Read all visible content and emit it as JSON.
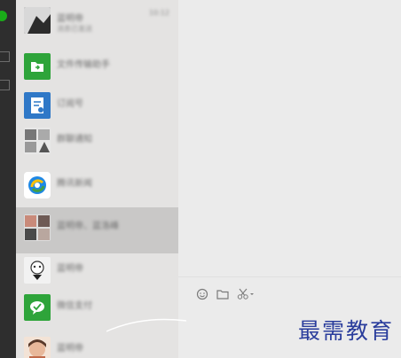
{
  "sidebar": {
    "colors": {
      "rail": "#2e2e2e",
      "active": "#1aad19"
    }
  },
  "chats": [
    {
      "name": "蓝明帝",
      "preview": "消息已发送",
      "time": "10:12",
      "avatar_icon": "photo-avatar-icon"
    },
    {
      "name": "文件传输助手",
      "preview": "",
      "time": "",
      "avatar_icon": "file-transfer-icon"
    },
    {
      "name": "订阅号",
      "preview": "",
      "time": "",
      "avatar_icon": "subscription-icon"
    },
    {
      "name": "群聊通知",
      "preview": "",
      "time": "",
      "avatar_icon": "group-avatar-icon"
    },
    {
      "name": "腾讯新闻",
      "preview": "",
      "time": "",
      "avatar_icon": "tencent-news-icon"
    },
    {
      "name": "蓝明帝、蓝洛峰",
      "preview": "",
      "time": "",
      "avatar_icon": "group-photo-icon"
    },
    {
      "name": "蓝明帝",
      "preview": "",
      "time": "",
      "avatar_icon": "sticker-avatar-icon"
    },
    {
      "name": "微信支付",
      "preview": "",
      "time": "",
      "avatar_icon": "wechat-pay-icon"
    },
    {
      "name": "蓝明帝",
      "preview": "",
      "time": "",
      "avatar_icon": "portrait-avatar-icon"
    }
  ],
  "toolbar": {
    "emoji_icon": "emoji-icon",
    "file_icon": "folder-icon",
    "screenshot_icon": "scissors-icon"
  },
  "watermark": "最需教育"
}
